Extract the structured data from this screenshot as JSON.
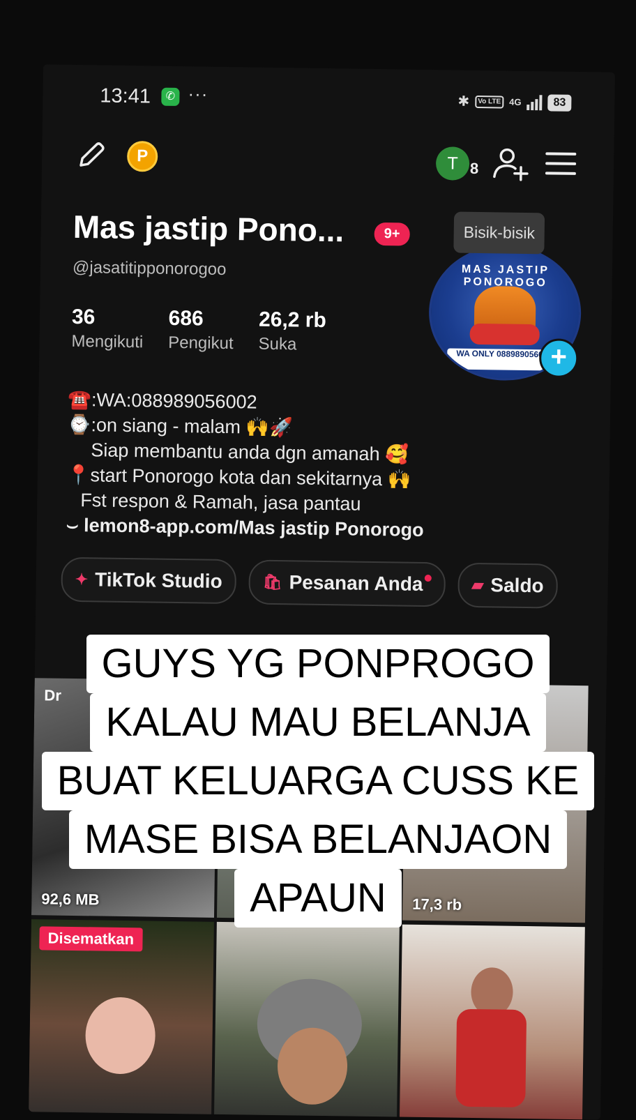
{
  "status": {
    "time": "13:41",
    "battery": "83",
    "network": "4G",
    "volte": "Vo LTE"
  },
  "topbar": {
    "coin_label": "P",
    "avatar_letter": "T",
    "avatar_count": "8"
  },
  "profile": {
    "name": "Mas jastip Pono...",
    "notif_badge": "9+",
    "handle": "@jasatitipponorogoo",
    "bisik_label": "Bisik-bisik",
    "pic_text_top": "MAS JASTIP PONOROGO",
    "pic_text_wa": "WA ONLY 088989056002",
    "stats": [
      {
        "num": "36",
        "label": "Mengikuti"
      },
      {
        "num": "686",
        "label": "Pengikut"
      },
      {
        "num": "26,2 rb",
        "label": "Suka"
      }
    ],
    "bio": [
      "☎️:WA:088989056002",
      "⌚:on siang - malam 🙌🚀",
      "Siap membantu anda dgn amanah 🥰",
      "📍start Ponorogo kota dan sekitarnya 🙌",
      "Fst respon & Ramah, jasa pantau",
      "lemon8-app.com/Mas jastip Ponorogo"
    ],
    "link_icon": "⌣"
  },
  "actions": [
    {
      "icon": "✦",
      "label": "TikTok Studio"
    },
    {
      "icon": "🛍",
      "label": "Pesanan Anda"
    },
    {
      "icon": "▰",
      "label": "Saldo"
    }
  ],
  "grid": {
    "draft_label": "Dr",
    "size_label": "92,6 MB",
    "views_label": "17,3 rb",
    "pinned_label": "Disematkan"
  },
  "caption": {
    "lines": [
      "GUYS YG PONPROGO",
      "KALAU MAU BELANJA",
      "BUAT KELUARGA CUSS KE",
      "MASE BISA BELANJAON",
      "APAUN"
    ]
  }
}
